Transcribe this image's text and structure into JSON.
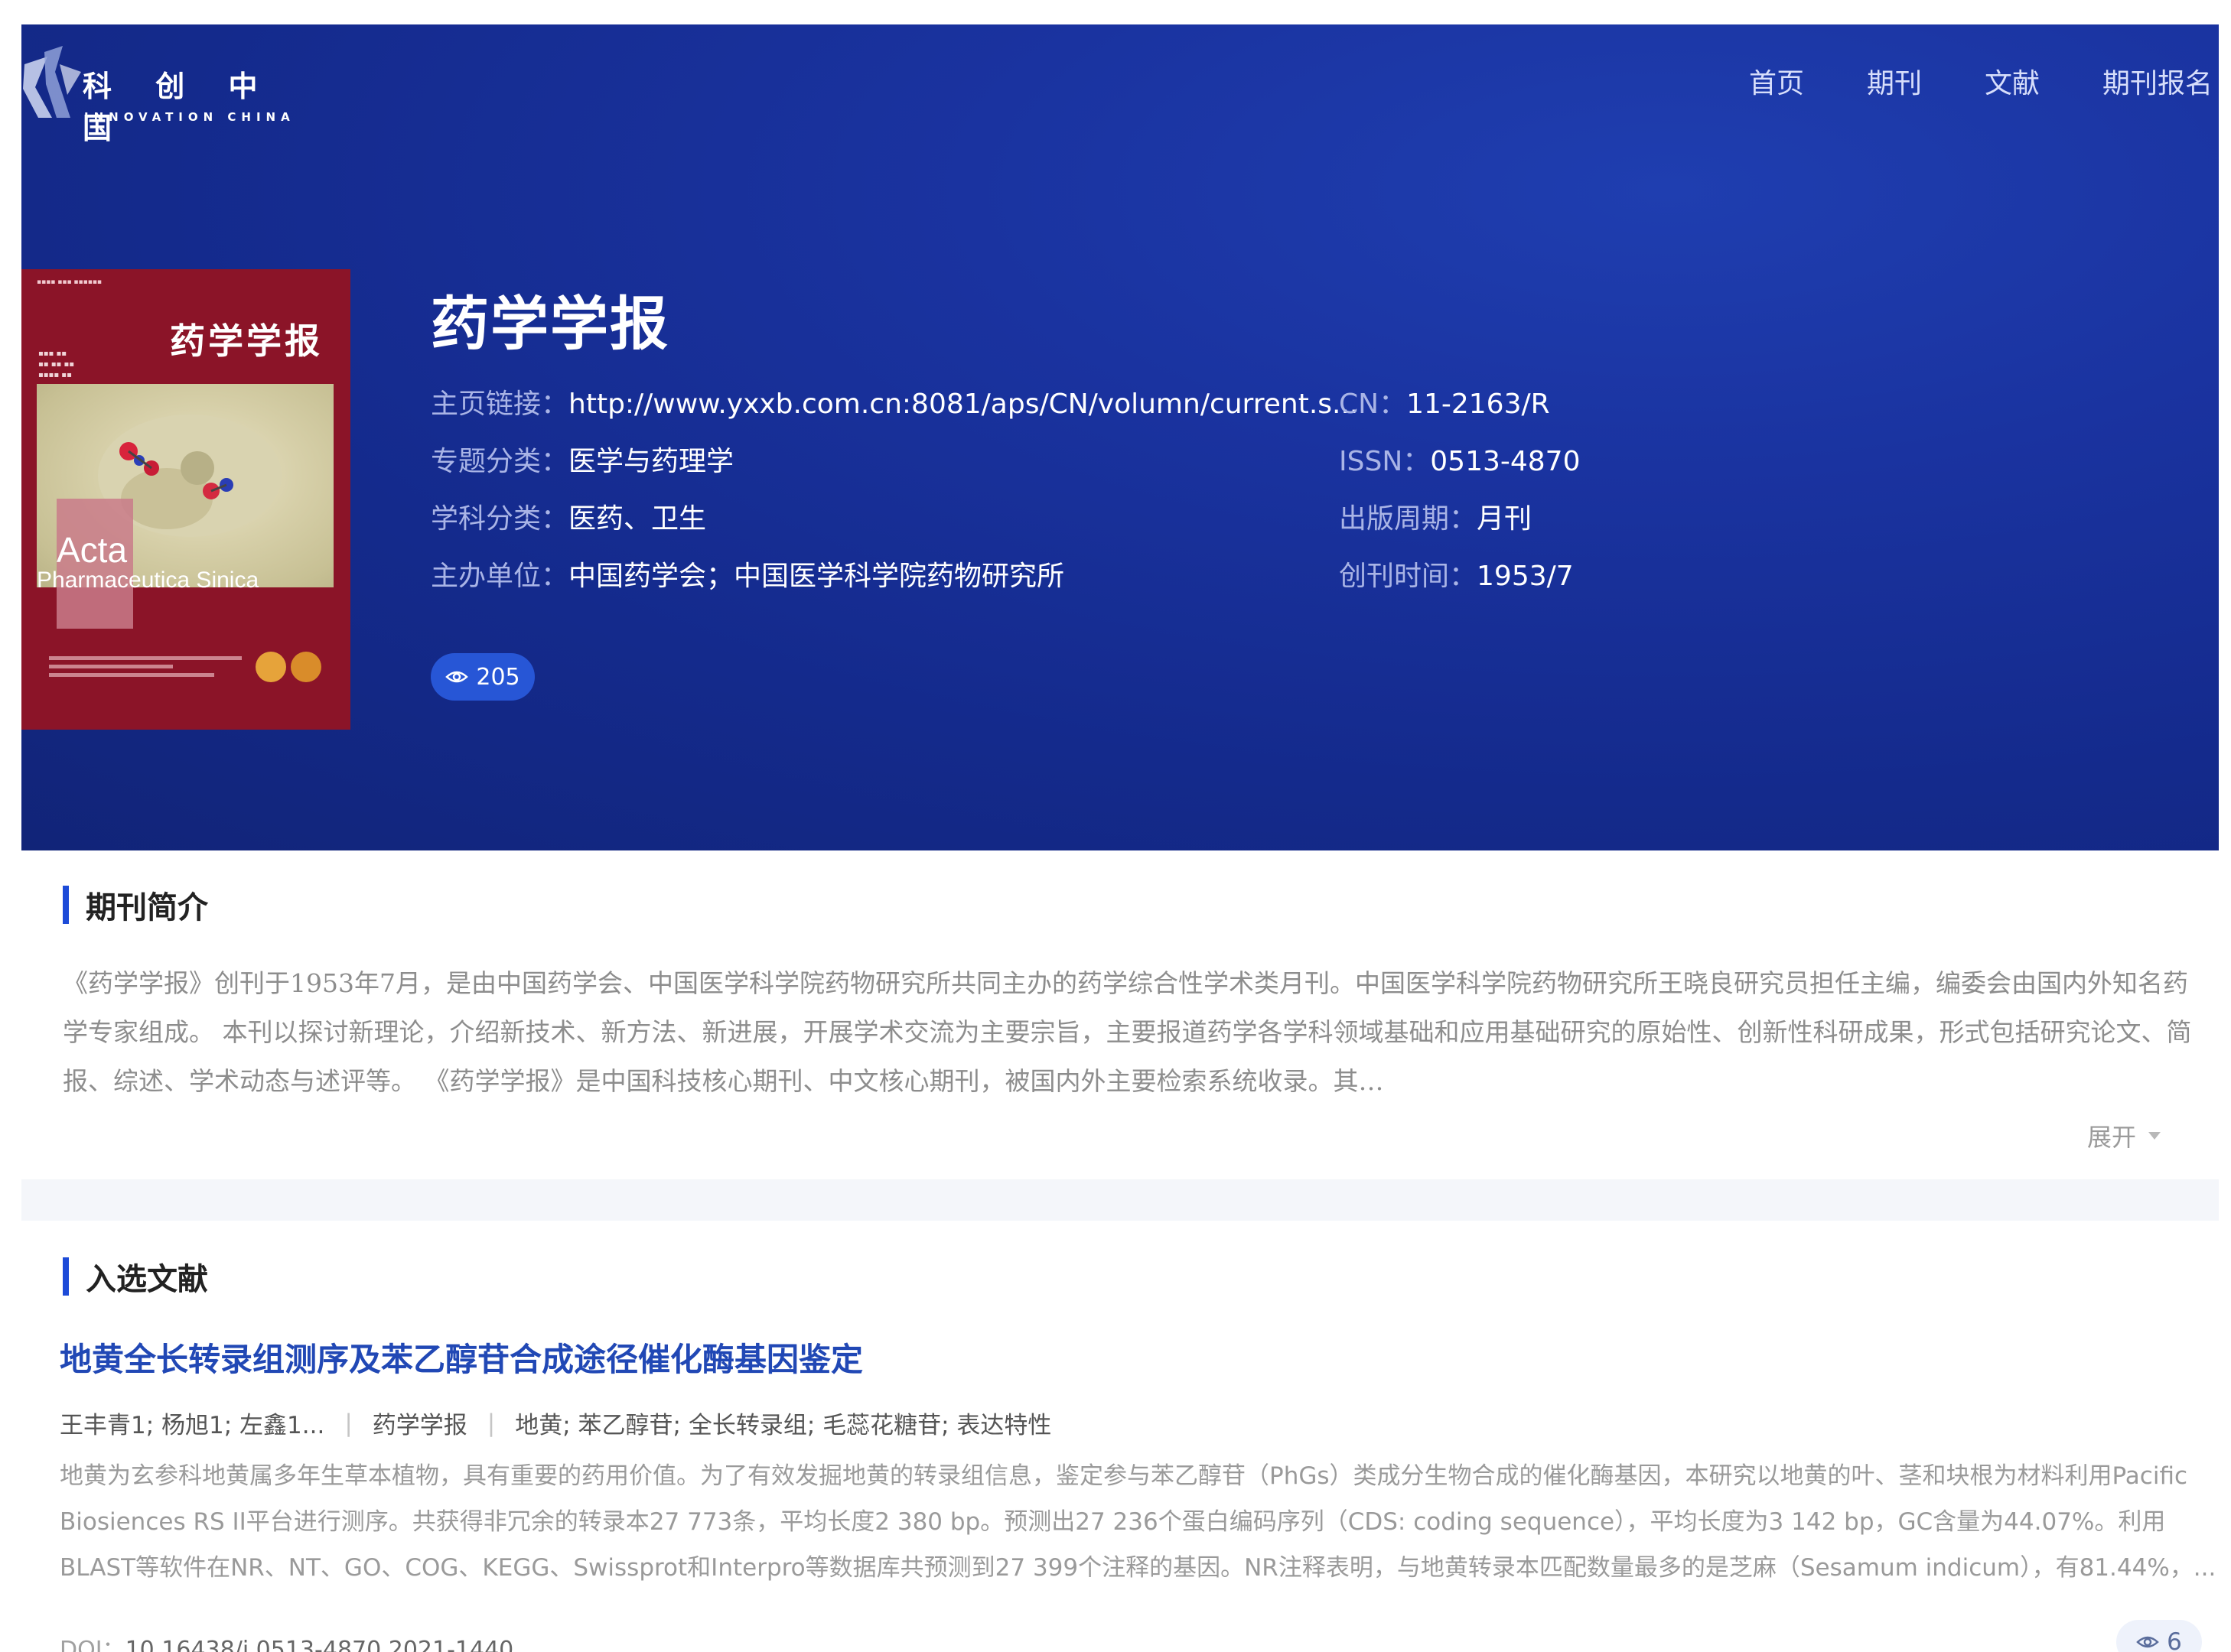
{
  "header": {
    "logo_cn": "科 创 中 国",
    "logo_en": "INNOVATION CHINA",
    "nav": [
      "首页",
      "期刊",
      "文献",
      "期刊报名"
    ]
  },
  "cover": {
    "title": "药学学报",
    "latin_1": "Acta",
    "latin_2": "Pharmaceutica Sinica"
  },
  "journal": {
    "title": "药学学报",
    "fields_left": [
      {
        "label": "主页链接：",
        "value": "http://www.yxxb.com.cn:8081/aps/CN/volumn/current.s..."
      },
      {
        "label": "专题分类：",
        "value": "医学与药理学"
      },
      {
        "label": "学科分类：",
        "value": "医药、卫生"
      },
      {
        "label": "主办单位：",
        "value": "中国药学会；中国医学科学院药物研究所"
      }
    ],
    "fields_right": [
      {
        "label": "CN：",
        "value": "11-2163/R"
      },
      {
        "label": "ISSN：",
        "value": "0513-4870"
      },
      {
        "label": "出版周期：",
        "value": "月刊"
      },
      {
        "label": "创刊时间：",
        "value": "1953/7"
      }
    ],
    "views": "205"
  },
  "intro": {
    "heading": "期刊简介",
    "text": "《药学学报》创刊于1953年7月，是由中国药学会、中国医学科学院药物研究所共同主办的药学综合性学术类月刊。中国医学科学院药物研究所王晓良研究员担任主编，编委会由国内外知名药学专家组成。 本刊以探讨新理论，介绍新技术、新方法、新进展，开展学术交流为主要宗旨，主要报道药学各学科领域基础和应用基础研究的原始性、创新性科研成果，形式包括研究论文、简报、综述、学术动态与述评等。 《药学学报》是中国科技核心期刊、中文核心期刊，被国内外主要检索系统收录。其…",
    "expand_label": "展开"
  },
  "selected": {
    "heading": "入选文献",
    "article": {
      "title": "地黄全长转录组测序及苯乙醇苷合成途径催化酶基因鉴定",
      "authors": "王丰青1; 杨旭1; 左鑫1...",
      "journal": "药学学报",
      "keywords": "地黄; 苯乙醇苷; 全长转录组; 毛蕊花糖苷; 表达特性",
      "abstract": "地黄为玄参科地黄属多年生草本植物，具有重要的药用价值。为了有效发掘地黄的转录组信息，鉴定参与苯乙醇苷（PhGs）类成分生物合成的催化酶基因，本研究以地黄的叶、茎和块根为材料利用Pacific Biosiences RS II平台进行测序。共获得非冗余的转录本27 773条，平均长度2 380 bp。预测出27 236个蛋白编码序列（CDS: coding sequence），平均长度为3 142 bp，GC含量为44.07%。利用BLAST等软件在NR、NT、GO、COG、KEGG、Swissprot和Interpro等数据库共预测到27 399个注释的基因。NR注释表明，与地黄转录本匹配数量最多的是芝麻（Sesamum indicum），有81.44%，...",
      "doi_label": "DOI：",
      "doi": "10.16438/j.0513-4870.2021-1440",
      "views": "6"
    }
  },
  "colors": {
    "hero_bg": "#142a8c",
    "accent": "#1d4bd8",
    "article_title": "#2148b5",
    "cover": "#8b1428"
  }
}
